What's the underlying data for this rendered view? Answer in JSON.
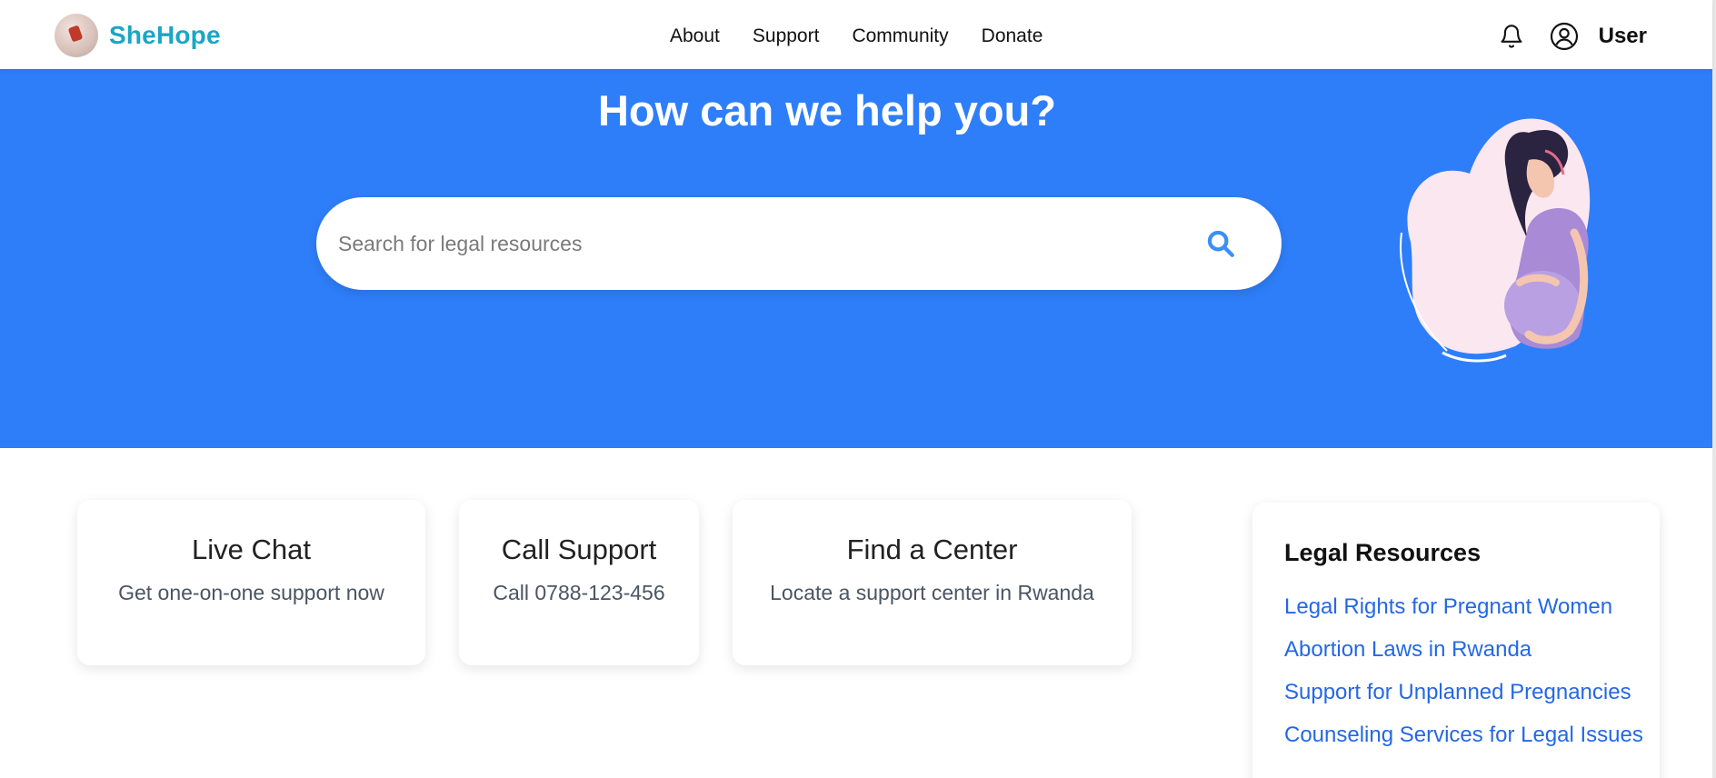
{
  "header": {
    "brand": "SheHope",
    "nav": [
      {
        "label": "About"
      },
      {
        "label": "Support"
      },
      {
        "label": "Community"
      },
      {
        "label": "Donate"
      }
    ],
    "user_label": "User",
    "icons": {
      "notifications": "bell-icon",
      "account": "user-circle-icon"
    }
  },
  "hero": {
    "title": "How can we help you?",
    "search": {
      "placeholder": "Search for legal resources",
      "value": ""
    },
    "background": "#2e7ef9"
  },
  "cards": [
    {
      "title": "Live Chat",
      "subtitle": "Get one-on-one support now"
    },
    {
      "title": "Call Support",
      "subtitle": "Call 0788-123-456"
    },
    {
      "title": "Find a Center",
      "subtitle": "Locate a support center in Rwanda"
    }
  ],
  "legal_resources": {
    "title": "Legal Resources",
    "links": [
      {
        "label": "Legal Rights for Pregnant Women"
      },
      {
        "label": "Abortion Laws in Rwanda"
      },
      {
        "label": "Support for Unplanned Pregnancies"
      },
      {
        "label": "Counseling Services for Legal Issues"
      }
    ]
  },
  "colors": {
    "brand": "#1aa6c6",
    "accent": "#2e7ef9",
    "link": "#2468e6"
  }
}
